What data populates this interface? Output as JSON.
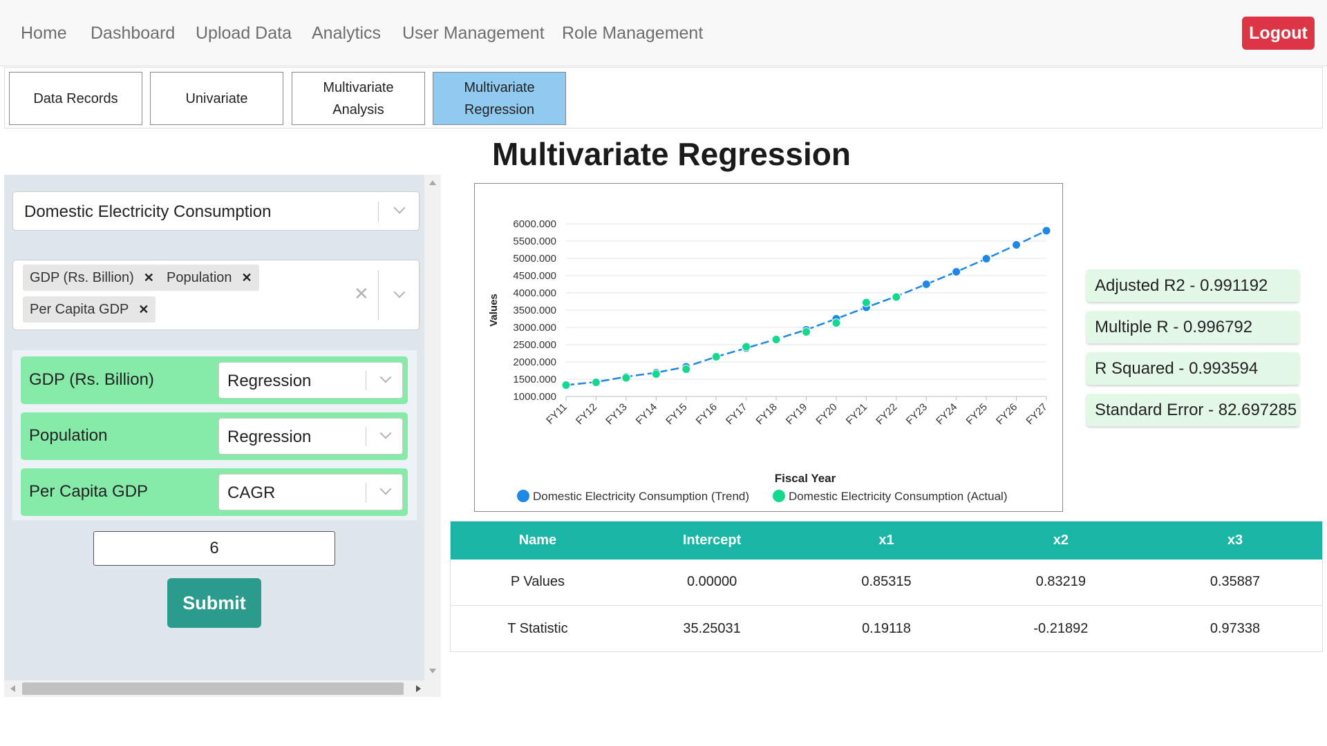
{
  "nav": {
    "links": [
      "Home",
      "Dashboard",
      "Upload Data",
      "Analytics",
      "User Management",
      "Role Management"
    ],
    "logout_label": "Logout"
  },
  "tabs": [
    {
      "label": "Data Records",
      "active": false
    },
    {
      "label": "Univariate",
      "active": false
    },
    {
      "label": "Multivariate Analysis",
      "active": false
    },
    {
      "label": "Multivariate Regression",
      "active": true
    }
  ],
  "form": {
    "dependent_variable": "Domestic Electricity Consumption",
    "independent_variables": [
      "GDP (Rs. Billion)",
      "Population",
      "Per Capita GDP"
    ],
    "variable_methods": [
      {
        "variable": "GDP (Rs. Billion)",
        "method": "Regression"
      },
      {
        "variable": "Population",
        "method": "Regression"
      },
      {
        "variable": "Per Capita GDP",
        "method": "CAGR"
      }
    ],
    "years_value": "6",
    "submit_label": "Submit"
  },
  "page_title": "Multivariate Regression",
  "metrics": [
    "Adjusted R2 - 0.991192",
    "Multiple R - 0.996792",
    "R Squared - 0.993594",
    "Standard Error - 82.697285"
  ],
  "table": {
    "headers": [
      "Name",
      "Intercept",
      "x1",
      "x2",
      "x3"
    ],
    "rows": [
      [
        "P Values",
        "0.00000",
        "0.85315",
        "0.83219",
        "0.35887"
      ],
      [
        "T Statistic",
        "35.25031",
        "0.19118",
        "-0.21892",
        "0.97338"
      ]
    ]
  },
  "colors": {
    "accent_tab": "#90caf0",
    "logout": "#dc3545",
    "submit": "#2b9b8e",
    "variable_row": "#86eaa8",
    "table_header": "#19b5a5",
    "trend": "#1e88e5",
    "actual": "#13d98f"
  },
  "chart_data": {
    "type": "line",
    "xlabel": "Fiscal Year",
    "ylabel": "Values",
    "ylim": [
      1000,
      6000
    ],
    "y_tick_step": 500,
    "y_tick_format": "0.000",
    "grid": true,
    "legend_position": "bottom",
    "categories": [
      "FY11",
      "FY12",
      "FY13",
      "FY14",
      "FY15",
      "FY16",
      "FY17",
      "FY18",
      "FY19",
      "FY20",
      "FY21",
      "FY22",
      "FY23",
      "FY24",
      "FY25",
      "FY26",
      "FY27"
    ],
    "series": [
      {
        "name": "Domestic Electricity Consumption (Trend)",
        "color": "#1e88e5",
        "values": [
          1330,
          1420,
          1570,
          1690,
          1860,
          2150,
          2400,
          2660,
          2930,
          3250,
          3580,
          3900,
          4250,
          4610,
          4990,
          5390,
          5800
        ]
      },
      {
        "name": "Domestic Electricity Consumption (Actual)",
        "color": "#13d98f",
        "values": [
          1330,
          1410,
          1540,
          1650,
          1790,
          2150,
          2440,
          2650,
          2870,
          3130,
          3720,
          3880,
          null,
          null,
          null,
          null,
          null
        ]
      }
    ]
  }
}
